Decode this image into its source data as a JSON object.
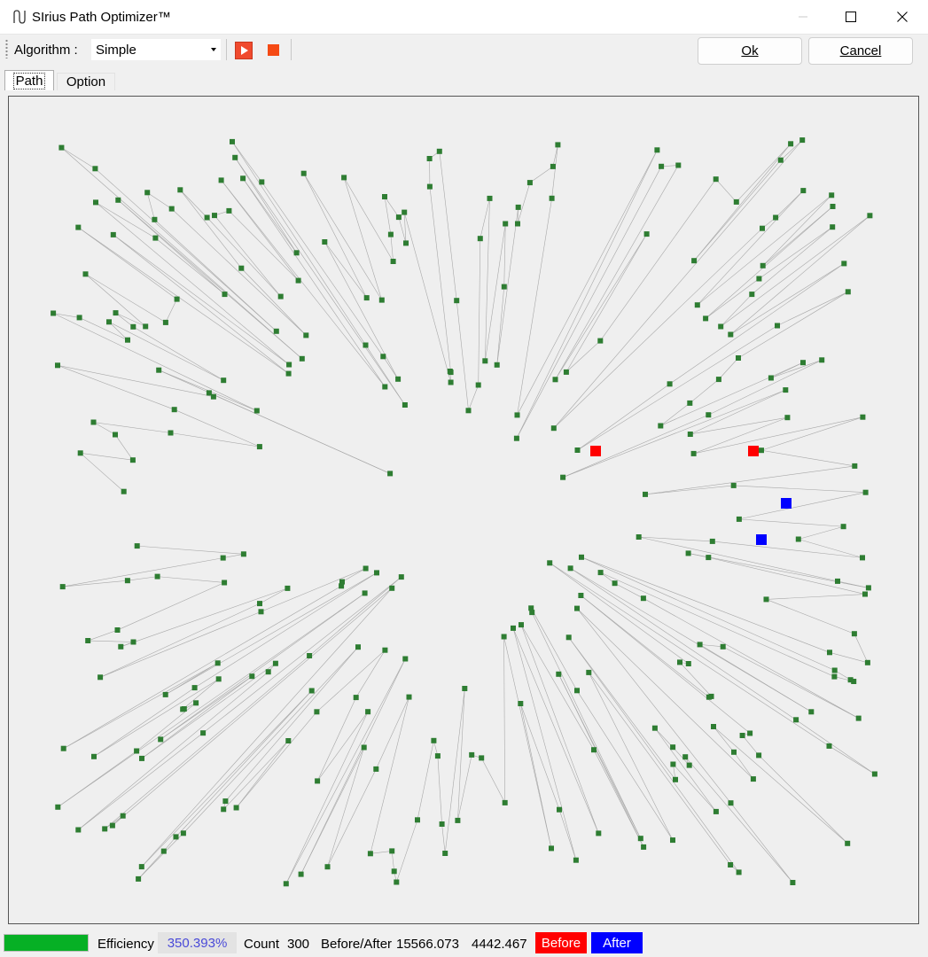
{
  "window": {
    "title": "SIrius Path Optimizer™",
    "app_icon": "wave-glyph-icon"
  },
  "toolbar": {
    "algorithm_label": "Algorithm :",
    "algorithm_value": "Simple",
    "ok_label": "Ok",
    "cancel_label": "Cancel",
    "play_color": "#f04a2e",
    "stop_color": "#f54a14"
  },
  "tabs": [
    {
      "label": "Path",
      "active": true
    },
    {
      "label": "Option",
      "active": false
    }
  ],
  "status": {
    "progress_fraction": 1.0,
    "efficiency_label": "Efficiency",
    "efficiency_value": "350.393%",
    "count_label": "Count",
    "count_value": "300",
    "before_after_label": "Before/After",
    "before_value": "15566.073",
    "after_value": "4442.467",
    "before_label": "Before",
    "after_label": "After"
  },
  "colors": {
    "point": "#2e7d32",
    "path": "#a8a8a8",
    "before": "#ff0000",
    "after": "#0000ff"
  }
}
